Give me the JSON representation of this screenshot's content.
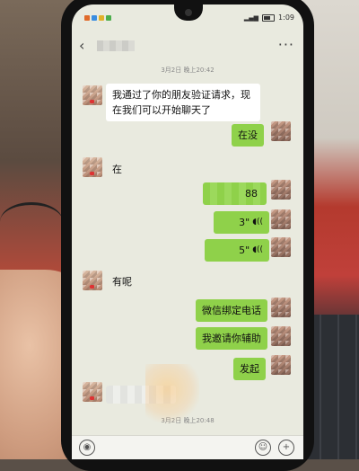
{
  "chat": {
    "timestamps": [
      "3月2日 晚上20:42",
      "3月2日 晚上20:48"
    ],
    "status_time": "1:09",
    "messages": [
      {
        "side": "in",
        "text": "我通过了你的朋友验证请求，现在我们可以开始聊天了"
      },
      {
        "side": "out",
        "text": "在没"
      },
      {
        "side": "in",
        "text": "在"
      },
      {
        "side": "out",
        "text": "88",
        "partially_obscured": true
      },
      {
        "side": "out",
        "type": "voice",
        "text": "3\""
      },
      {
        "side": "out",
        "type": "voice",
        "text": "5\""
      },
      {
        "side": "in",
        "text": "有呢"
      },
      {
        "side": "out",
        "text": "微信绑定电话"
      },
      {
        "side": "out",
        "text": "我邀请你辅助"
      },
      {
        "side": "out",
        "text": "发起"
      }
    ]
  },
  "icons": {
    "back": "chevron-left-icon",
    "more": "more-icon",
    "voice_input": "voice-icon",
    "emoji": "emoji-icon",
    "plus": "plus-icon"
  },
  "colors": {
    "chat_background": "#e9eadf",
    "outgoing_bubble": "#8fd14a",
    "incoming_bubble": "#ffffff"
  }
}
